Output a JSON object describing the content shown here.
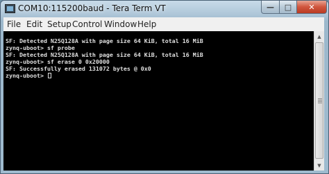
{
  "window": {
    "title": "COM10:115200baud - Tera Term VT",
    "minimize_glyph": "—",
    "maximize_glyph": "□",
    "close_glyph": "✕"
  },
  "menu": {
    "items": [
      "File",
      "Edit",
      "Setup",
      "Control",
      "Window",
      "Help"
    ]
  },
  "terminal": {
    "lines": [
      "SF: Detected N25Q128A with page size 64 KiB, total 16 MiB",
      "zynq-uboot> sf probe",
      "SF: Detected N25Q128A with page size 64 KiB, total 16 MiB",
      "zynq-uboot> sf erase 0 0x20000",
      "SF: Successfully erased 131072 bytes @ 0x0",
      "zynq-uboot> "
    ]
  },
  "icons": {
    "app": "tera-term-icon",
    "scroll_up": "arrow-up-icon",
    "scroll_down": "arrow-down-icon"
  },
  "colors": {
    "terminal_bg": "#000000",
    "terminal_fg": "#e0e0e0",
    "close_button": "#c9452d"
  }
}
